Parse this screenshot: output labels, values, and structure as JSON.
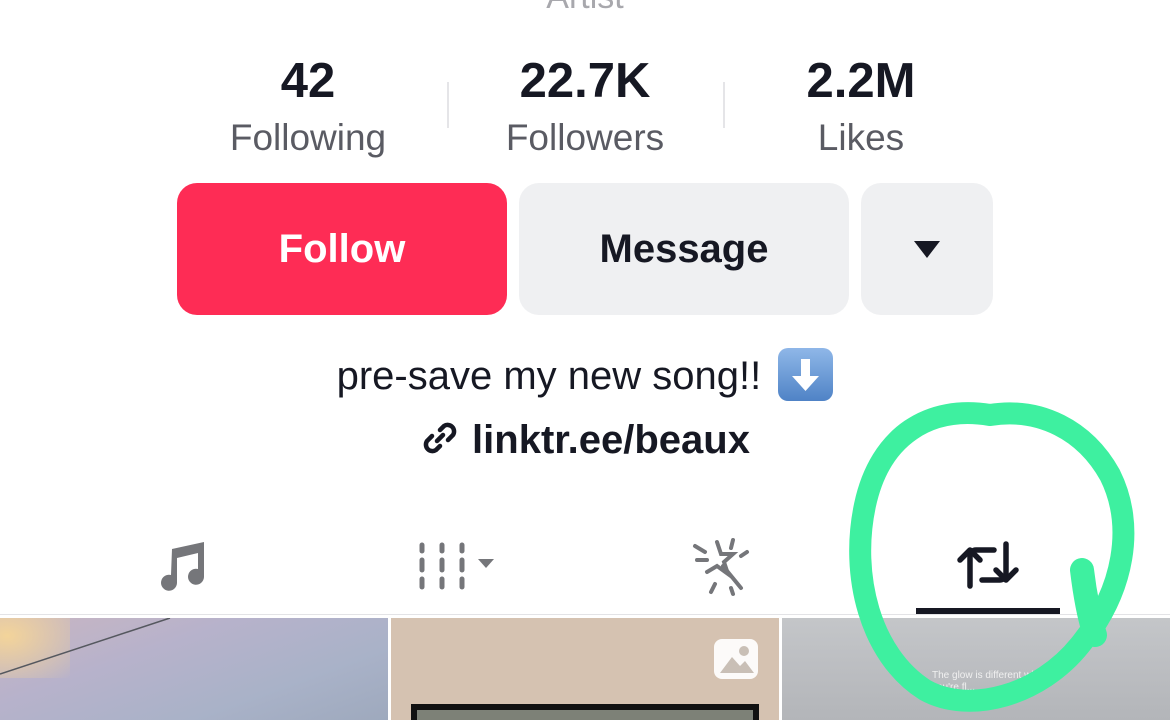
{
  "profile": {
    "role": "Artist"
  },
  "stats": [
    {
      "value": "42",
      "label": "Following"
    },
    {
      "value": "22.7K",
      "label": "Followers"
    },
    {
      "value": "2.2M",
      "label": "Likes"
    }
  ],
  "actions": {
    "follow_label": "Follow",
    "message_label": "Message",
    "more_icon": "caret-down-icon"
  },
  "bio": {
    "text": "pre-save my new song!!",
    "emoji": "down-arrow-emoji",
    "link": "linktr.ee/beaux",
    "link_icon": "link-icon"
  },
  "tabs": [
    {
      "icon": "music-note-icon",
      "active": false
    },
    {
      "icon": "videos-grid-icon",
      "active": false
    },
    {
      "icon": "magic-wand-icon",
      "active": false
    },
    {
      "icon": "repost-icon",
      "active": true
    }
  ],
  "grid": {
    "items": [
      {
        "type": "video"
      },
      {
        "type": "photo",
        "badge": "photo-icon"
      },
      {
        "type": "video",
        "caption": "The glow is different when you're fl..."
      }
    ]
  },
  "colors": {
    "follow": "#fe2c55",
    "secondary_button": "#eff0f2",
    "text": "#161823",
    "muted_text": "#5a5b63",
    "annotation": "#3ef0a0"
  }
}
